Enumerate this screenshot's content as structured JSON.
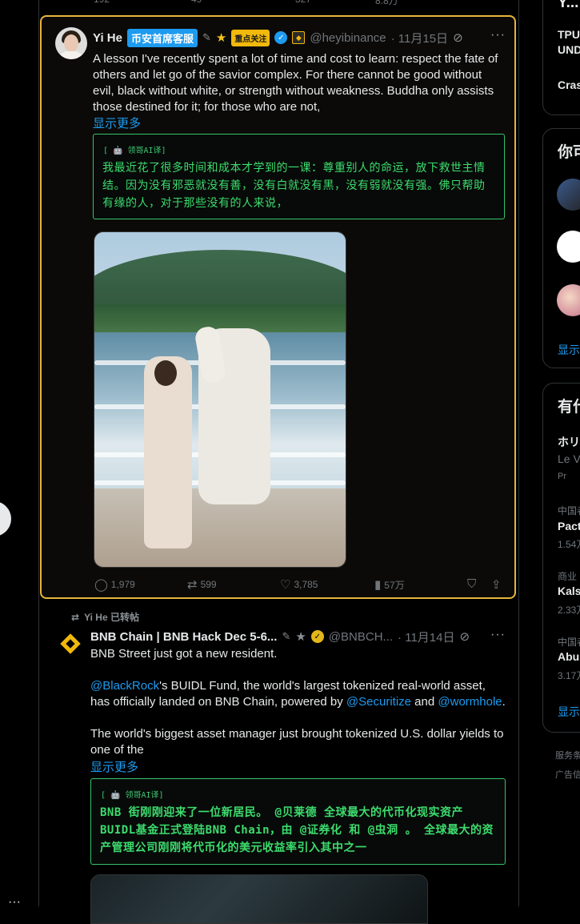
{
  "top_strip": {
    "values": [
      "192",
      "49",
      "327",
      "8.8万"
    ]
  },
  "tweet1": {
    "name": "Yi He",
    "badge_title": "币安首席客服",
    "badge_follow": "重点关注",
    "handle": "@heyibinance",
    "date": "· 11月15日",
    "text": "A lesson I've recently spent a lot of time and cost to learn: respect the fate of others and let go of the savior complex. For there cannot be good without evil, black without white, or strength without weakness. Buddha only assists those destined for it; for those who are not,",
    "show_more": "显示更多",
    "translation_tag": "[ 🤖 领哥AI译]",
    "translation": "我最近花了很多时间和成本才学到的一课：尊重别人的命运，放下救世主情结。因为没有邪恶就没有善，没有白就没有黑，没有弱就没有强。佛只帮助有缘的人，对于那些没有的人来说，",
    "stats": {
      "replies": "1,979",
      "reposts": "599",
      "likes": "3,785",
      "views": "57万"
    }
  },
  "retweet_label": "Yi He 已转帖",
  "tweet2": {
    "name": "BNB Chain | BNB Hack Dec 5-6...",
    "handle": "@BNBCH...",
    "date": "· 11月14日",
    "line1": "BNB Street just got a new resident.",
    "mention_blackrock": "@BlackRock",
    "p2_a": "'s BUIDL Fund, the world's largest tokenized real-world asset, has officially landed on BNB Chain, powered by ",
    "mention_securitize": "@Securitize",
    "p2_and": " and ",
    "mention_wormhole": "@wormhole",
    "p2_end": ".",
    "p3": "The world's biggest asset manager just brought tokenized U.S. dollar yields to one of the",
    "show_more": "显示更多",
    "translation_tag": "[ 🤖 领哥AI译]",
    "translation": "BNB 街刚刚迎来了一位新居民。 @贝莱德 全球最大的代币化现实资产BUIDL基金正式登陆BNB Chain，由 @证券化 和 @虫洞 。 全球最大的资产管理公司刚刚将代币化的美元收益率引入其中之一"
  },
  "sidebar": {
    "card1": {
      "head": "Y...",
      "item1": "TPU",
      "item1b": "UND",
      "item2": "Cras"
    },
    "card2": {
      "head": "你可",
      "show": "显示"
    },
    "card3": {
      "head": "有什",
      "t1": "ホリ",
      "t1sub": "Le Vo",
      "t1promo": "Pr",
      "c2": "中国者",
      "t2": "Pact",
      "n2": "1.54万",
      "c3": "商业",
      "t3": "Kalsh",
      "n3": "2.33万",
      "c4": "中国者",
      "t4": "Abu",
      "n4": "3.17万",
      "show": "显示"
    },
    "footer1": "服务条",
    "footer2": "广告信"
  },
  "icons": {
    "reply": "reply-icon",
    "repost": "repost-icon",
    "like": "heart-icon",
    "views": "views-icon",
    "bookmark": "bookmark-icon",
    "share": "share-icon"
  },
  "colors": {
    "highlight_border": "#e7b53b",
    "link": "#1d9bf0",
    "translation": "#3ddc6e",
    "badge_blue": "#1d9bf0",
    "badge_gold": "#f0b90b"
  }
}
